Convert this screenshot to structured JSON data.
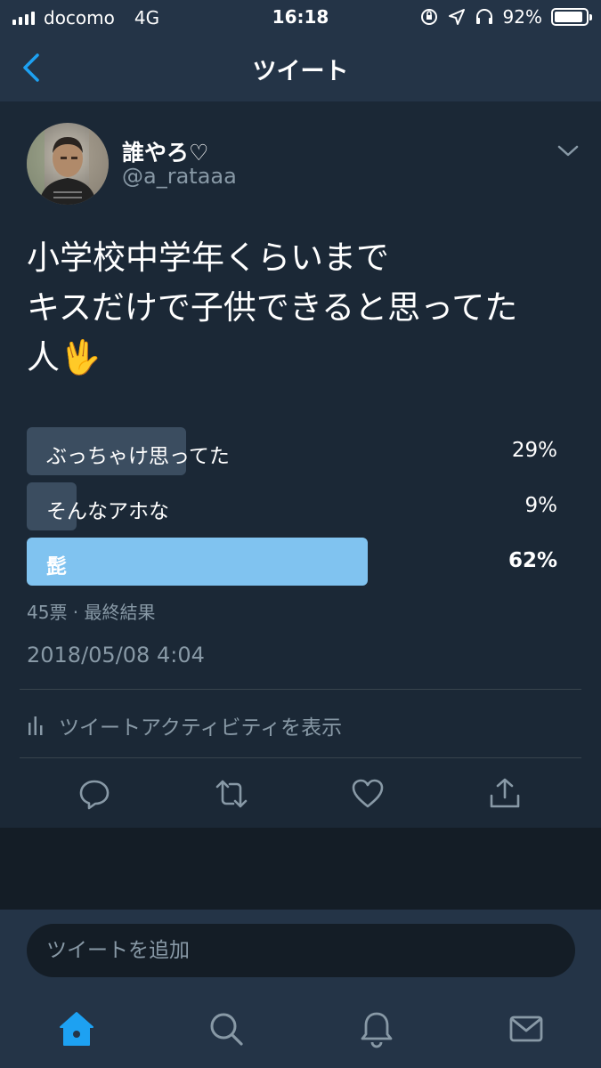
{
  "status_bar": {
    "carrier": "docomo",
    "network": "4G",
    "time": "16:18",
    "battery": "92%",
    "battery_level": 0.92
  },
  "nav": {
    "title": "ツイート",
    "back_icon": "chevron-left-icon"
  },
  "tweet": {
    "display_name": "誰やろ♡",
    "handle": "@a_rataaa",
    "text_lines": [
      "小学校中学年くらいまで",
      "キスだけで子供できると思ってた",
      "人🖖"
    ],
    "poll": {
      "options": [
        {
          "label": "ぶっちゃけ思ってた",
          "percent": "29%",
          "value": 29
        },
        {
          "label": "そんなアホな",
          "percent": "9%",
          "value": 9
        },
        {
          "label": "髭",
          "percent": "62%",
          "value": 62
        }
      ],
      "meta": "45票 · 最終結果"
    },
    "timestamp": "2018/05/08 4:04",
    "activity_label": "ツイートアクティビティを表示"
  },
  "reply": {
    "placeholder": "ツイートを追加"
  },
  "colors": {
    "accent": "#1da1f2",
    "poll_winner": "#80c3f0",
    "poll_bar": "#3b4d60",
    "muted_text": "#8899a6"
  }
}
